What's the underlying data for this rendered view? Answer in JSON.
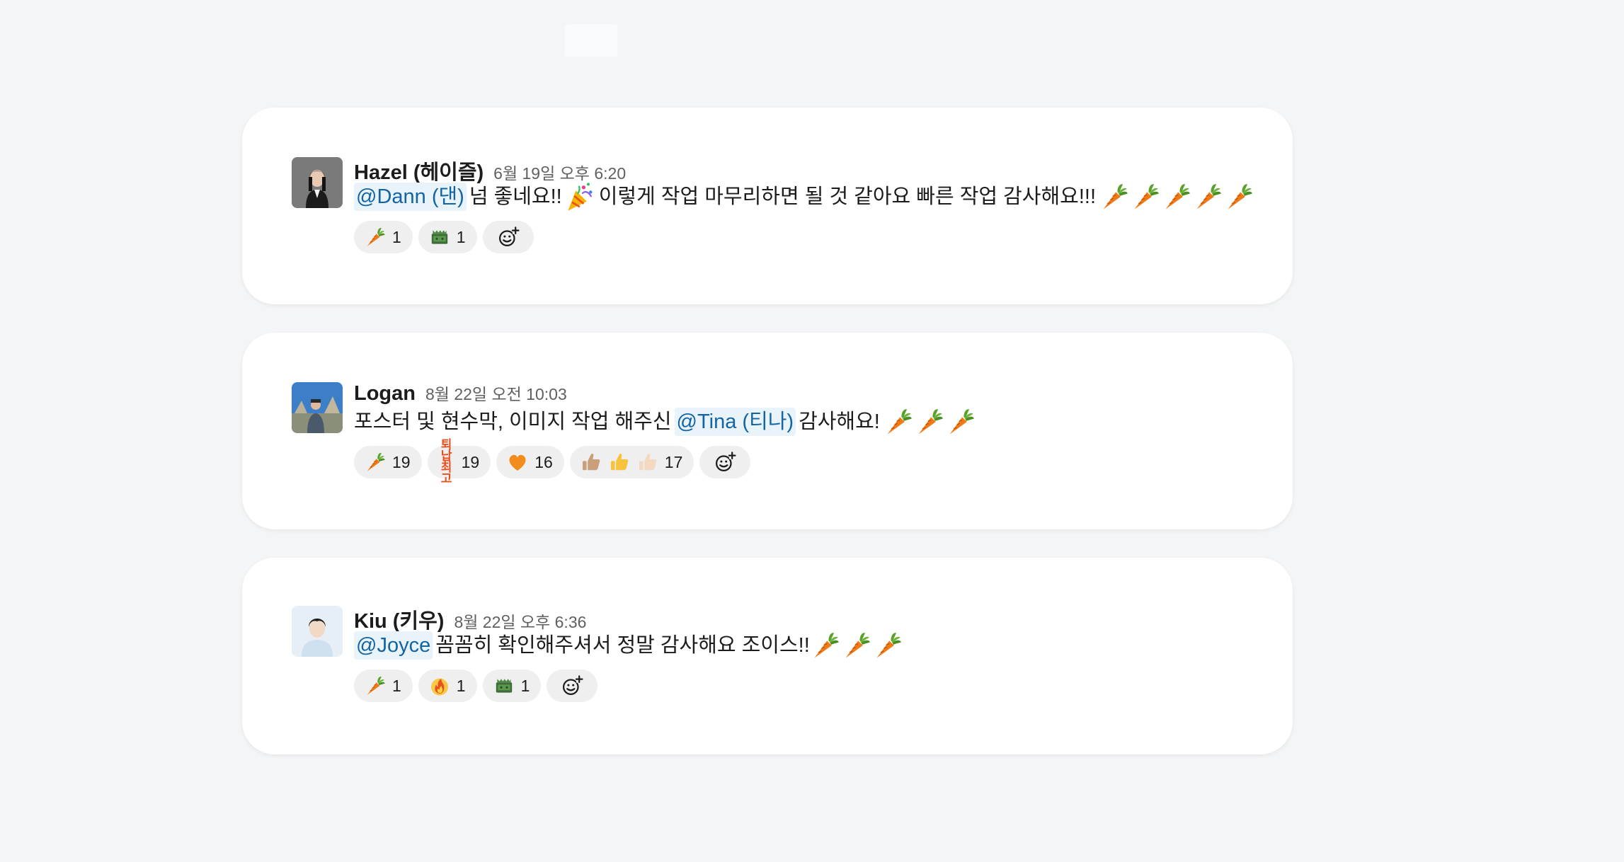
{
  "messages": [
    {
      "author": "Hazel (헤이즐)",
      "timestamp": "6월 19일 오후 6:20",
      "mention": "@Dann (댄)",
      "text_before": "넘 좋네요!!",
      "text_after": "이렇게 작업 마무리하면 될 것 같아요 빠른 작업 감사해요!!!",
      "trailing_emoji": [
        "carrot-icon",
        "carrot-icon",
        "carrot-icon",
        "carrot-icon",
        "carrot-icon"
      ],
      "reactions": [
        {
          "icon": "carrot-icon",
          "count": "1"
        },
        {
          "icon": "green-thumbs-icon",
          "count": "1"
        }
      ]
    },
    {
      "author": "Logan",
      "timestamp": "8월 22일 오전 10:03",
      "text_before": "포스터 및 현수막, 이미지 작업 해주신",
      "mention": "@Tina (티나)",
      "text_after": "감사해요!",
      "trailing_emoji": [
        "carrot-icon",
        "carrot-icon",
        "carrot-icon"
      ],
      "reactions": [
        {
          "icon": "carrot-icon",
          "count": "19"
        },
        {
          "icon": "custom-text-emoji-icon",
          "label": "퇴납 최고",
          "count": "19"
        },
        {
          "icon": "orange-heart-icon",
          "count": "16"
        },
        {
          "icon": "thumbs-up-icon",
          "count": "17"
        }
      ]
    },
    {
      "author": "Kiu (키우)",
      "timestamp": "8월 22일 오후 6:36",
      "mention": "@Joyce",
      "text_after": "꼼꼼히 확인해주셔서 정말 감사해요 조이스!!",
      "trailing_emoji": [
        "carrot-icon",
        "carrot-icon",
        "carrot-icon"
      ],
      "reactions": [
        {
          "icon": "carrot-icon",
          "count": "1"
        },
        {
          "icon": "fire-icon",
          "count": "1"
        },
        {
          "icon": "green-thumbs-icon",
          "count": "1"
        }
      ]
    }
  ],
  "colors": {
    "background": "#f4f5f6",
    "card": "#ffffff",
    "mention_bg": "#e8f3fa",
    "mention_text": "#1264a3",
    "reaction_bg": "#efeff0"
  }
}
